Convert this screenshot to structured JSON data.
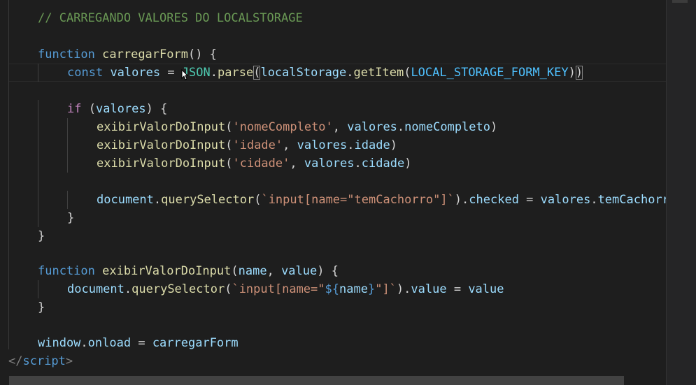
{
  "editor": {
    "lines": [
      {
        "indent": 1,
        "guides": 0,
        "tokens": [
          {
            "t": "// CARREGANDO VALORES DO LOCALSTORAGE",
            "c": "comment"
          }
        ]
      },
      {
        "indent": 0,
        "guides": 0,
        "tokens": []
      },
      {
        "indent": 1,
        "guides": 0,
        "tokens": [
          {
            "t": "function",
            "c": "kw"
          },
          {
            "t": " ",
            "c": "punc"
          },
          {
            "t": "carregarForm",
            "c": "fn"
          },
          {
            "t": "() {",
            "c": "punc"
          }
        ]
      },
      {
        "indent": 2,
        "guides": 1,
        "tokens": [
          {
            "t": "const",
            "c": "kw"
          },
          {
            "t": " ",
            "c": "punc"
          },
          {
            "t": "valores",
            "c": "var"
          },
          {
            "t": " = ",
            "c": "punc"
          },
          {
            "t": "JSON",
            "c": "obj"
          },
          {
            "t": ".",
            "c": "punc"
          },
          {
            "t": "parse",
            "c": "fn"
          },
          {
            "t": "(",
            "c": "punc",
            "box": true
          },
          {
            "t": "localStorage",
            "c": "var"
          },
          {
            "t": ".",
            "c": "punc"
          },
          {
            "t": "getItem",
            "c": "fn"
          },
          {
            "t": "(",
            "c": "punc"
          },
          {
            "t": "LOCAL_STORAGE_FORM_KEY",
            "c": "const"
          },
          {
            "t": ")",
            "c": "punc"
          },
          {
            "t": ")",
            "c": "punc",
            "box": true
          }
        ]
      },
      {
        "indent": 0,
        "guides": 0,
        "tokens": []
      },
      {
        "indent": 2,
        "guides": 1,
        "tokens": [
          {
            "t": "if",
            "c": "ctrl"
          },
          {
            "t": " (",
            "c": "punc"
          },
          {
            "t": "valores",
            "c": "var"
          },
          {
            "t": ") {",
            "c": "punc"
          }
        ]
      },
      {
        "indent": 3,
        "guides": 2,
        "tokens": [
          {
            "t": "exibirValorDoInput",
            "c": "fn"
          },
          {
            "t": "(",
            "c": "punc"
          },
          {
            "t": "'nomeCompleto'",
            "c": "str"
          },
          {
            "t": ", ",
            "c": "punc"
          },
          {
            "t": "valores",
            "c": "var"
          },
          {
            "t": ".",
            "c": "punc"
          },
          {
            "t": "nomeCompleto",
            "c": "var"
          },
          {
            "t": ")",
            "c": "punc"
          }
        ]
      },
      {
        "indent": 3,
        "guides": 2,
        "tokens": [
          {
            "t": "exibirValorDoInput",
            "c": "fn"
          },
          {
            "t": "(",
            "c": "punc"
          },
          {
            "t": "'idade'",
            "c": "str"
          },
          {
            "t": ", ",
            "c": "punc"
          },
          {
            "t": "valores",
            "c": "var"
          },
          {
            "t": ".",
            "c": "punc"
          },
          {
            "t": "idade",
            "c": "var"
          },
          {
            "t": ")",
            "c": "punc"
          }
        ]
      },
      {
        "indent": 3,
        "guides": 2,
        "tokens": [
          {
            "t": "exibirValorDoInput",
            "c": "fn"
          },
          {
            "t": "(",
            "c": "punc"
          },
          {
            "t": "'cidade'",
            "c": "str"
          },
          {
            "t": ", ",
            "c": "punc"
          },
          {
            "t": "valores",
            "c": "var"
          },
          {
            "t": ".",
            "c": "punc"
          },
          {
            "t": "cidade",
            "c": "var"
          },
          {
            "t": ")",
            "c": "punc"
          }
        ]
      },
      {
        "indent": 0,
        "guides": 2,
        "tokens": []
      },
      {
        "indent": 3,
        "guides": 2,
        "tokens": [
          {
            "t": "document",
            "c": "var"
          },
          {
            "t": ".",
            "c": "punc"
          },
          {
            "t": "querySelector",
            "c": "fn"
          },
          {
            "t": "(",
            "c": "punc"
          },
          {
            "t": "`input[name=\"temCachorro\"]`",
            "c": "str"
          },
          {
            "t": ").",
            "c": "punc"
          },
          {
            "t": "checked",
            "c": "var"
          },
          {
            "t": " = ",
            "c": "punc"
          },
          {
            "t": "valores",
            "c": "var"
          },
          {
            "t": ".",
            "c": "punc"
          },
          {
            "t": "temCachorro",
            "c": "var"
          }
        ]
      },
      {
        "indent": 2,
        "guides": 1,
        "tokens": [
          {
            "t": "}",
            "c": "punc"
          }
        ]
      },
      {
        "indent": 1,
        "guides": 0,
        "tokens": [
          {
            "t": "}",
            "c": "punc"
          }
        ]
      },
      {
        "indent": 0,
        "guides": 0,
        "tokens": []
      },
      {
        "indent": 1,
        "guides": 0,
        "tokens": [
          {
            "t": "function",
            "c": "kw"
          },
          {
            "t": " ",
            "c": "punc"
          },
          {
            "t": "exibirValorDoInput",
            "c": "fn"
          },
          {
            "t": "(",
            "c": "punc"
          },
          {
            "t": "name",
            "c": "var"
          },
          {
            "t": ", ",
            "c": "punc"
          },
          {
            "t": "value",
            "c": "var"
          },
          {
            "t": ") {",
            "c": "punc"
          }
        ]
      },
      {
        "indent": 2,
        "guides": 1,
        "tokens": [
          {
            "t": "document",
            "c": "var"
          },
          {
            "t": ".",
            "c": "punc"
          },
          {
            "t": "querySelector",
            "c": "fn"
          },
          {
            "t": "(",
            "c": "punc"
          },
          {
            "t": "`input[name=\"",
            "c": "str"
          },
          {
            "t": "${",
            "c": "kw"
          },
          {
            "t": "name",
            "c": "var"
          },
          {
            "t": "}",
            "c": "kw"
          },
          {
            "t": "\"]`",
            "c": "str"
          },
          {
            "t": ").",
            "c": "punc"
          },
          {
            "t": "value",
            "c": "var"
          },
          {
            "t": " = ",
            "c": "punc"
          },
          {
            "t": "value",
            "c": "var"
          }
        ]
      },
      {
        "indent": 1,
        "guides": 0,
        "tokens": [
          {
            "t": "}",
            "c": "punc"
          }
        ]
      },
      {
        "indent": 0,
        "guides": 0,
        "tokens": []
      },
      {
        "indent": 1,
        "guides": 0,
        "tokens": [
          {
            "t": "window",
            "c": "var"
          },
          {
            "t": ".",
            "c": "punc"
          },
          {
            "t": "onload",
            "c": "var"
          },
          {
            "t": " = ",
            "c": "punc"
          },
          {
            "t": "carregarForm",
            "c": "var"
          }
        ]
      },
      {
        "indent": 0,
        "guides": 0,
        "tokens": [
          {
            "t": "</",
            "c": "tag"
          },
          {
            "t": "script",
            "c": "tagname"
          },
          {
            "t": ">",
            "c": "tag"
          }
        ]
      }
    ]
  }
}
